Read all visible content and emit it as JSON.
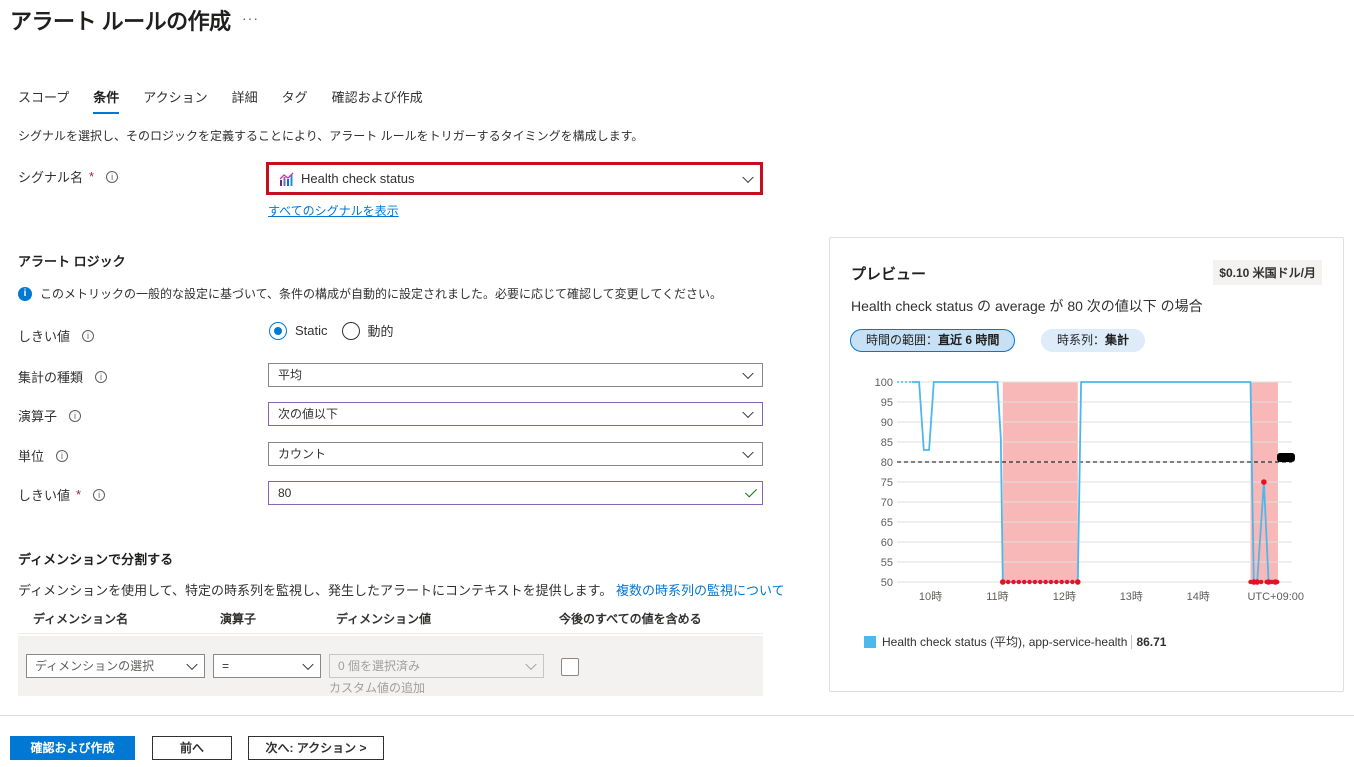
{
  "page": {
    "title": "アラート ルールの作成",
    "more": "···"
  },
  "tabs": [
    {
      "label": "スコープ",
      "active": false
    },
    {
      "label": "条件",
      "active": true
    },
    {
      "label": "アクション",
      "active": false
    },
    {
      "label": "詳細",
      "active": false
    },
    {
      "label": "タグ",
      "active": false
    },
    {
      "label": "確認および作成",
      "active": false
    }
  ],
  "description": "シグナルを選択し、そのロジックを定義することにより、アラート ルールをトリガーするタイミングを構成します。",
  "signal": {
    "label": "シグナル名",
    "required": "*",
    "value": "Health check status",
    "link": "すべてのシグナルを表示",
    "icon": "metric-chart-icon"
  },
  "alert_logic": {
    "title": "アラート ロジック",
    "info_text": "このメトリックの一般的な設定に基づいて、条件の構成が自動的に設定されました。必要に応じて確認して変更してください。",
    "threshold_label": "しきい値",
    "threshold_options": [
      "Static",
      "動的"
    ],
    "threshold_selected": "Static",
    "aggregation_label": "集計の種類",
    "aggregation_value": "平均",
    "operator_label": "演算子",
    "operator_value": "次の値以下",
    "unit_label": "単位",
    "unit_value": "カウント",
    "threshold_value_label": "しきい値",
    "threshold_value_required": "*",
    "threshold_value": "80"
  },
  "dimensions": {
    "title": "ディメンションで分割する",
    "desc": "ディメンションを使用して、特定の時系列を監視し、発生したアラートにコンテキストを提供します。",
    "link": "複数の時系列の監視について",
    "headers": [
      "ディメンション名",
      "演算子",
      "ディメンション値",
      "今後のすべての値を含める"
    ],
    "name_placeholder": "ディメンションの選択",
    "operator_value": "=",
    "value_placeholder": "0 個を選択済み",
    "custom_value": "カスタム値の追加"
  },
  "footer": {
    "review_create": "確認および作成",
    "previous": "前へ",
    "next": "次へ: アクション >"
  },
  "preview": {
    "title": "プレビュー",
    "cost": "$0.10 米国ドル/月",
    "condition": "Health check status の average が 80 次の値以下 の場合",
    "time_range_label": "時間の範囲：",
    "time_range_value": "直近 6 時間",
    "timeseries_label": "時系列：",
    "timeseries_value": "集計",
    "legend_text": "Health check status (平均), app-service-health",
    "legend_value": "86.71"
  },
  "chart_data": {
    "type": "line",
    "y_ticks": [
      "100",
      "95",
      "90",
      "85",
      "80",
      "75",
      "70",
      "65",
      "60",
      "55",
      "50"
    ],
    "x_ticks": [
      "10時",
      "11時",
      "12時",
      "13時",
      "14時"
    ],
    "x_unit_label": "UTC+09:00",
    "ylim": [
      50,
      100
    ],
    "xlim": [
      9.5,
      15.4
    ],
    "threshold": 80,
    "series": [
      {
        "name": "Health check status (平均), app-service-health",
        "color": "#4cb8ec",
        "points": [
          [
            9.72,
            100
          ],
          [
            9.83,
            100
          ],
          [
            9.9,
            83
          ],
          [
            9.98,
            83
          ],
          [
            10.05,
            100
          ],
          [
            11.0,
            100
          ],
          [
            11.05,
            86
          ],
          [
            11.08,
            50
          ],
          [
            12.2,
            50
          ],
          [
            12.25,
            100
          ],
          [
            14.78,
            100
          ],
          [
            14.83,
            50
          ],
          [
            14.88,
            50
          ],
          [
            14.98,
            75
          ],
          [
            15.05,
            50
          ],
          [
            15.15,
            50
          ]
        ]
      }
    ],
    "alert_regions": [
      [
        11.08,
        12.2
      ],
      [
        14.78,
        15.19
      ]
    ],
    "alert_color": "#f8b8b8",
    "threshold_color": "#000000"
  }
}
